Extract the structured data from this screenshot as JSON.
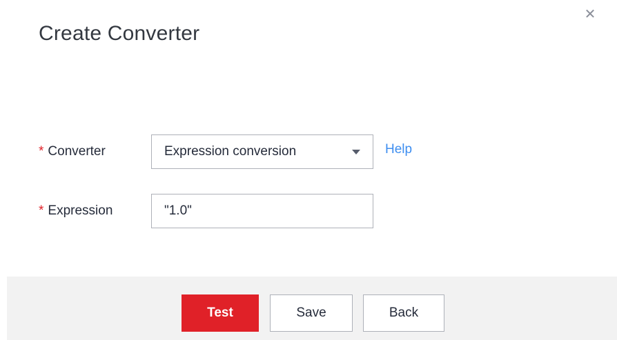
{
  "dialog": {
    "title": "Create Converter",
    "close_icon": "close-icon"
  },
  "form": {
    "required_marker": "*",
    "converter": {
      "label": "Converter",
      "selected_value": "Expression conversion",
      "help_link": "Help"
    },
    "expression": {
      "label": "Expression",
      "value": "\"1.0\""
    }
  },
  "footer": {
    "test_label": "Test",
    "save_label": "Save",
    "back_label": "Back"
  },
  "colors": {
    "primary_button": "#e02128",
    "required_asterisk": "#e02128",
    "link": "#3e8ef0",
    "footer_bg": "#f2f2f2"
  }
}
